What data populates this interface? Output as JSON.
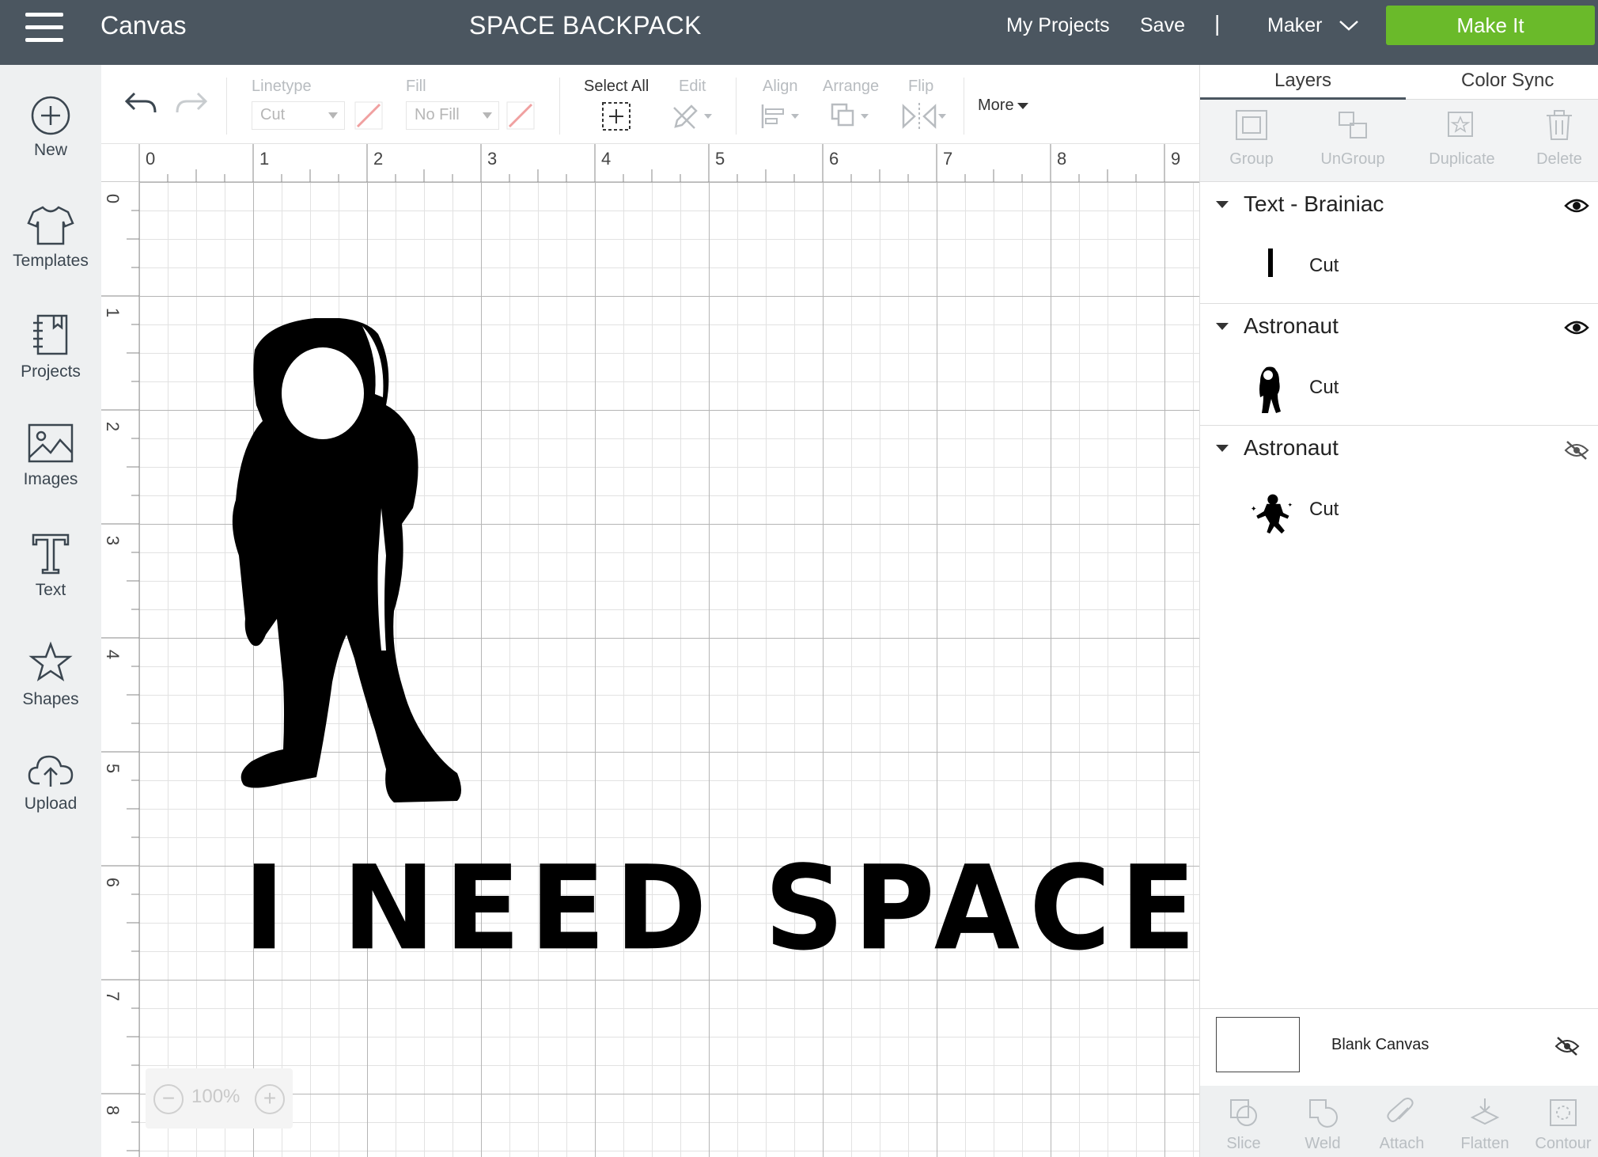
{
  "topbar": {
    "app_title": "Canvas",
    "project_title": "SPACE BACKPACK",
    "my_projects": "My Projects",
    "save": "Save",
    "separator": "|",
    "machine": "Maker",
    "make_it": "Make It",
    "make_it_color": "#6aba2a",
    "bar_color": "#4b5660"
  },
  "sidebar": {
    "items": [
      {
        "label": "New",
        "icon": "plus-circle-icon"
      },
      {
        "label": "Templates",
        "icon": "tshirt-icon"
      },
      {
        "label": "Projects",
        "icon": "notebook-icon"
      },
      {
        "label": "Images",
        "icon": "image-icon"
      },
      {
        "label": "Text",
        "icon": "text-t-icon"
      },
      {
        "label": "Shapes",
        "icon": "shapes-icon"
      },
      {
        "label": "Upload",
        "icon": "cloud-upload-icon"
      }
    ]
  },
  "toolbar": {
    "linetype_label": "Linetype",
    "linetype_value": "Cut",
    "fill_label": "Fill",
    "fill_value": "No Fill",
    "select_all": "Select All",
    "edit": "Edit",
    "align": "Align",
    "arrange": "Arrange",
    "flip": "Flip",
    "more": "More"
  },
  "canvas": {
    "ruler_x": [
      "0",
      "1",
      "2",
      "3",
      "4",
      "5",
      "6",
      "7",
      "8",
      "9"
    ],
    "ruler_y": [
      "0",
      "1",
      "2",
      "3",
      "4",
      "5",
      "6",
      "7",
      "8"
    ],
    "text": "I NEED SPACE",
    "zoom": "100%",
    "zoom_minus": "−",
    "zoom_plus": "+"
  },
  "panel": {
    "tabs": [
      "Layers",
      "Color Sync"
    ],
    "actions": [
      "Group",
      "UnGroup",
      "Duplicate",
      "Delete"
    ],
    "layers": [
      {
        "name": "Text - Brainiac",
        "sub": "Cut",
        "visible": true
      },
      {
        "name": "Astronaut",
        "sub": "Cut",
        "visible": true
      },
      {
        "name": "Astronaut",
        "sub": "Cut",
        "visible": false
      }
    ],
    "blank_canvas": "Blank Canvas",
    "bottom_actions": [
      "Slice",
      "Weld",
      "Attach",
      "Flatten",
      "Contour"
    ]
  }
}
